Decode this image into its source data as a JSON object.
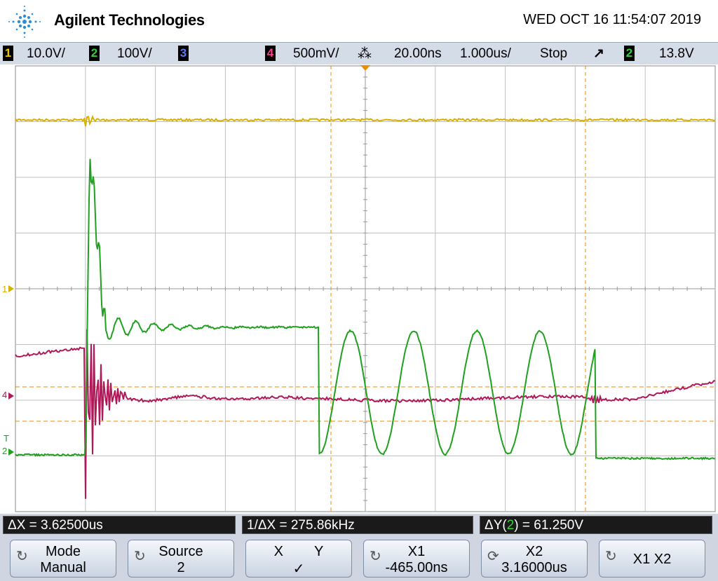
{
  "header": {
    "brand": "Agilent Technologies",
    "datetime": "WED OCT 16 11:54:07 2019"
  },
  "status": {
    "ch1_num": "1",
    "ch1_scale": "10.0V/",
    "ch2_num": "2",
    "ch2_scale": "100V/",
    "ch3_num": "3",
    "ch4_num": "4",
    "ch4_scale": "500mV/",
    "time_delay": "20.00ns",
    "time_scale": "1.000us/",
    "run_state": "Stop",
    "trigger_slope": "↗",
    "trigger_src": "2",
    "trigger_level": "13.8V"
  },
  "markers": {
    "ch1": "1",
    "ch4": "4",
    "trig": "T",
    "ch2": "2"
  },
  "measurements": {
    "delta_x": "ΔX = 3.62500us",
    "inv_delta_x": "1/ΔX = 275.86kHz",
    "delta_y_prefix": "ΔY(",
    "delta_y_ch": "2",
    "delta_y_suffix": ") = 61.250V"
  },
  "softkeys": [
    {
      "l1": "Mode",
      "l2": "Manual"
    },
    {
      "l1": "Source",
      "l2": "2"
    },
    {
      "l1": "X        Y",
      "l2": "✓"
    },
    {
      "l1": "X1",
      "l2": "-465.00ns"
    },
    {
      "l1": "X2",
      "l2": "3.16000us"
    },
    {
      "l1": "X1 X2",
      "l2": ""
    }
  ],
  "colors": {
    "ch1": "#d8b000",
    "ch2": "#1fa01f",
    "ch3": "#3b5fd4",
    "ch4": "#b0185a",
    "cursor": "#f08a00",
    "grid": "#c0c0c0",
    "status_bg": "#d4dce8"
  },
  "chart_data": {
    "type": "line",
    "series": [
      {
        "name": "1",
        "channel": 1,
        "description_level_div": 3.0
      },
      {
        "name": "2",
        "channel": 2
      },
      {
        "name": "4",
        "channel": 4
      }
    ],
    "xlim_div": [
      0,
      10
    ],
    "ylim_div": [
      -4,
      4
    ],
    "grid": true
  }
}
